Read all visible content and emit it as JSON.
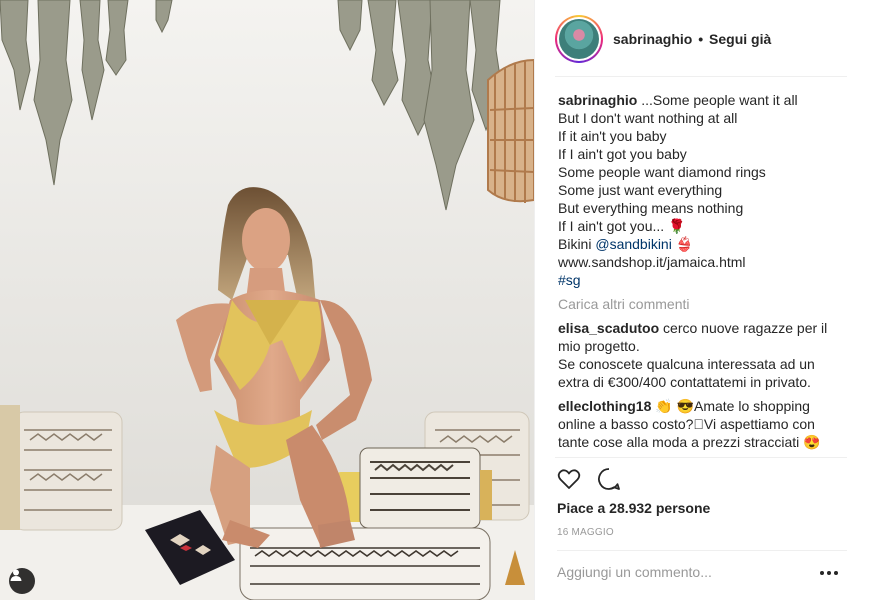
{
  "post": {
    "username": "sabrinaghio",
    "separator": "•",
    "follow_status": "Segui già",
    "caption": {
      "username": "sabrinaghio",
      "lines": [
        "...Some people want it all",
        "But I don't want nothing at all",
        "If it ain't you baby",
        "If I ain't got you baby",
        "Some people want diamond rings",
        "Some just want everything",
        "But everything means nothing",
        "If I ain't got you... 🌹"
      ],
      "bikini_prefix": "Bikini",
      "bikini_mention": "@sandbikini",
      "bikini_emoji": "👙",
      "url": "www.sandshop.it/jamaica.html",
      "hashtag": "#sg"
    },
    "load_more_label": "Carica altri commenti",
    "comments": [
      {
        "username": "elisa_scadutoo",
        "text": "cerco nuove ragazze per il mio progetto.",
        "text2": "Se conoscete qualcuna interessata ad un extra di €300/400 contattatemi in privato."
      },
      {
        "username": "elleclothing18",
        "text": "👏 😎Amate lo shopping online a basso costo?🏻Vi aspettiamo con tante cose alla moda a prezzi stracciati 😍"
      }
    ],
    "likes_text": "Piace a 28.932 persone",
    "date": "16 MAGGIO",
    "add_comment_placeholder": "Aggiungi un commento...",
    "icons": {
      "like": "heart-icon",
      "comment": "speech-bubble-icon",
      "options": "more-options-icon",
      "tagged_user": "person-tag-icon"
    }
  }
}
